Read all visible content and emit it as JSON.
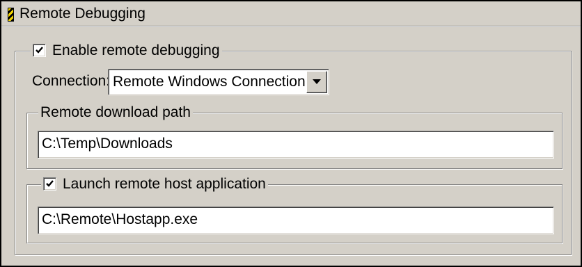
{
  "panel": {
    "title": "Remote Debugging",
    "icon": "striped-flag-icon"
  },
  "enable_group": {
    "checkbox_label": "Enable remote debugging",
    "checked": true
  },
  "connection": {
    "label": "Connection:",
    "selected": "Remote Windows Connection"
  },
  "download_group": {
    "legend": "Remote download path",
    "value": "C:\\Temp\\Downloads"
  },
  "launch_group": {
    "checkbox_label": "Launch remote host application",
    "checked": true,
    "value": "C:\\Remote\\Hostapp.exe"
  },
  "colors": {
    "face": "#d4d0c8",
    "shadow": "#808080",
    "highlight": "#ffffff",
    "field": "#ffffff"
  }
}
